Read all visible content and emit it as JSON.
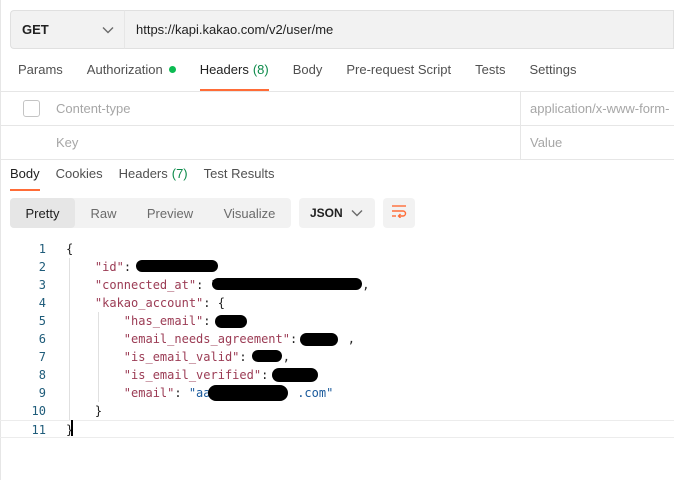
{
  "request": {
    "method": "GET",
    "url": "https://kapi.kakao.com/v2/user/me"
  },
  "request_tabs": [
    {
      "label": "Params",
      "active": false
    },
    {
      "label": "Authorization",
      "active": false,
      "dot": true
    },
    {
      "label": "Headers",
      "count": "(8)",
      "active": true
    },
    {
      "label": "Body",
      "active": false
    },
    {
      "label": "Pre-request Script",
      "active": false
    },
    {
      "label": "Tests",
      "active": false
    },
    {
      "label": "Settings",
      "active": false
    }
  ],
  "headers_table": {
    "rows": [
      {
        "key": "Content-type",
        "value": "application/x-www-form-"
      },
      {
        "key": "Key",
        "value": "Value"
      }
    ]
  },
  "response_tabs": [
    {
      "label": "Body",
      "active": true
    },
    {
      "label": "Cookies",
      "active": false
    },
    {
      "label": "Headers",
      "count": "(7)",
      "active": false
    },
    {
      "label": "Test Results",
      "active": false
    }
  ],
  "view_modes": [
    "Pretty",
    "Raw",
    "Preview",
    "Visualize"
  ],
  "active_view": "Pretty",
  "format": "JSON",
  "icons": {
    "method_dropdown": "chevron-down-icon",
    "format_dropdown": "chevron-down-icon",
    "wrap": "wrap-lines-icon"
  },
  "colors": {
    "accent": "#ff6c37",
    "status_green": "#0cbb52",
    "json_key": "#9b3b54",
    "json_string": "#1a5a9c"
  },
  "response_body": {
    "line_numbers": [
      "1",
      "2",
      "3",
      "4",
      "5",
      "6",
      "7",
      "8",
      "9",
      "10",
      "11"
    ],
    "lines": [
      {
        "parts": [
          {
            "t": "{",
            "c": "p"
          }
        ]
      },
      {
        "parts": [
          {
            "t": "    ",
            "c": "p"
          },
          {
            "t": "\"id\"",
            "c": "k"
          },
          {
            "t": ": ",
            "c": "p"
          }
        ]
      },
      {
        "parts": [
          {
            "t": "    ",
            "c": "p"
          },
          {
            "t": "\"connected_at\"",
            "c": "k"
          },
          {
            "t": ": \"",
            "c": "p"
          },
          {
            "t": "                   ",
            "c": "p"
          },
          {
            "t": "\",",
            "c": "p"
          }
        ]
      },
      {
        "parts": [
          {
            "t": "    ",
            "c": "p"
          },
          {
            "t": "\"kakao_account\"",
            "c": "k"
          },
          {
            "t": ": {",
            "c": "p"
          }
        ]
      },
      {
        "parts": [
          {
            "t": "        ",
            "c": "p"
          },
          {
            "t": "\"has_email\"",
            "c": "k"
          },
          {
            "t": ": ",
            "c": "p"
          }
        ]
      },
      {
        "parts": [
          {
            "t": "        ",
            "c": "p"
          },
          {
            "t": "\"email_needs_agreement\"",
            "c": "k"
          },
          {
            "t": ":       ,",
            "c": "p"
          }
        ]
      },
      {
        "parts": [
          {
            "t": "        ",
            "c": "p"
          },
          {
            "t": "\"is_email_valid\"",
            "c": "k"
          },
          {
            "t": ":     ,",
            "c": "p"
          }
        ]
      },
      {
        "parts": [
          {
            "t": "        ",
            "c": "p"
          },
          {
            "t": "\"is_email_verified\"",
            "c": "k"
          },
          {
            "t": ": ",
            "c": "p"
          }
        ]
      },
      {
        "parts": [
          {
            "t": "        ",
            "c": "p"
          },
          {
            "t": "\"email\"",
            "c": "k"
          },
          {
            "t": ": ",
            "c": "p"
          },
          {
            "t": "\"aa            .com\"",
            "c": "s"
          }
        ]
      },
      {
        "parts": [
          {
            "t": "    }",
            "c": "p"
          }
        ]
      },
      {
        "parts": [
          {
            "t": "}",
            "c": "p"
          }
        ]
      }
    ]
  }
}
